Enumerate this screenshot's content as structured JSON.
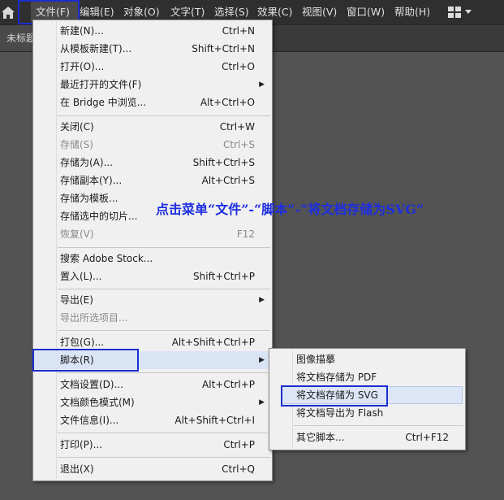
{
  "menubar": {
    "items": [
      {
        "label": "文件(F)"
      },
      {
        "label": "编辑(E)"
      },
      {
        "label": "对象(O)"
      },
      {
        "label": "文字(T)"
      },
      {
        "label": "选择(S)"
      },
      {
        "label": "效果(C)"
      },
      {
        "label": "视图(V)"
      },
      {
        "label": "窗口(W)"
      },
      {
        "label": "帮助(H)"
      }
    ]
  },
  "tabbar": {
    "tab_label": "未标题"
  },
  "file_menu": {
    "items": [
      {
        "label": "新建(N)...",
        "shortcut": "Ctrl+N"
      },
      {
        "label": "从模板新建(T)...",
        "shortcut": "Shift+Ctrl+N"
      },
      {
        "label": "打开(O)...",
        "shortcut": "Ctrl+O"
      },
      {
        "label": "最近打开的文件(F)",
        "shortcut": ""
      },
      {
        "label": "在 Bridge 中浏览...",
        "shortcut": "Alt+Ctrl+O"
      },
      {
        "label": "关闭(C)",
        "shortcut": "Ctrl+W"
      },
      {
        "label": "存储(S)",
        "shortcut": "Ctrl+S"
      },
      {
        "label": "存储为(A)...",
        "shortcut": "Shift+Ctrl+S"
      },
      {
        "label": "存储副本(Y)...",
        "shortcut": "Alt+Ctrl+S"
      },
      {
        "label": "存储为模板...",
        "shortcut": ""
      },
      {
        "label": "存储选中的切片...",
        "shortcut": ""
      },
      {
        "label": "恢复(V)",
        "shortcut": "F12"
      },
      {
        "label": "搜索 Adobe Stock...",
        "shortcut": ""
      },
      {
        "label": "置入(L)...",
        "shortcut": "Shift+Ctrl+P"
      },
      {
        "label": "导出(E)",
        "shortcut": ""
      },
      {
        "label": "导出所选项目...",
        "shortcut": ""
      },
      {
        "label": "打包(G)...",
        "shortcut": "Alt+Shift+Ctrl+P"
      },
      {
        "label": "脚本(R)",
        "shortcut": ""
      },
      {
        "label": "文档设置(D)...",
        "shortcut": "Alt+Ctrl+P"
      },
      {
        "label": "文档颜色模式(M)",
        "shortcut": ""
      },
      {
        "label": "文件信息(I)...",
        "shortcut": "Alt+Shift+Ctrl+I"
      },
      {
        "label": "打印(P)...",
        "shortcut": "Ctrl+P"
      },
      {
        "label": "退出(X)",
        "shortcut": "Ctrl+Q"
      }
    ]
  },
  "scripts_submenu": {
    "items": [
      {
        "label": "图像描摹",
        "shortcut": ""
      },
      {
        "label": "将文档存储为 PDF",
        "shortcut": ""
      },
      {
        "label": "将文档存储为 SVG",
        "shortcut": ""
      },
      {
        "label": "将文档导出为 Flash",
        "shortcut": ""
      },
      {
        "label": "其它脚本...",
        "shortcut": "Ctrl+F12"
      }
    ]
  },
  "annotation": {
    "text": "点击菜单“文件”-“脚本”-“将文档存储为SVG”"
  },
  "colors": {
    "menubar_bg": "#2f2f2f",
    "menu_bg": "#f0f0f0",
    "highlight_box": "#1b2dcf",
    "annotation_text": "#1d2ee0",
    "canvas_bg": "#535353"
  }
}
